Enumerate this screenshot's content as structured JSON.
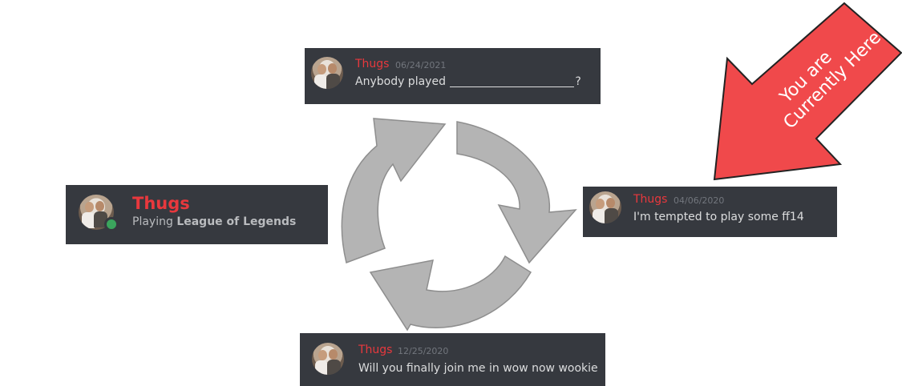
{
  "status": {
    "name": "Thugs",
    "activity_prefix": "Playing",
    "activity_game": "League of Legends"
  },
  "messages": {
    "top": {
      "name": "Thugs",
      "date": "06/24/2021",
      "text_before": "Anybody played",
      "text_after": "?"
    },
    "right": {
      "name": "Thugs",
      "date": "04/06/2020",
      "text": "I'm tempted to play some ff14"
    },
    "bottom": {
      "name": "Thugs",
      "date": "12/25/2020",
      "text": "Will you finally join me in wow now wookie"
    }
  },
  "callout": {
    "line1": "You are",
    "line2": "Currently Here"
  },
  "colors": {
    "card_bg": "#36393f",
    "username": "#e8383d",
    "cycle_arrow": "#b4b4b4",
    "callout_arrow": "#f0494b",
    "online": "#3ba55d"
  },
  "icons": [
    "cycle-arrows-icon",
    "pointer-arrow-icon",
    "avatar",
    "online-status-icon"
  ]
}
